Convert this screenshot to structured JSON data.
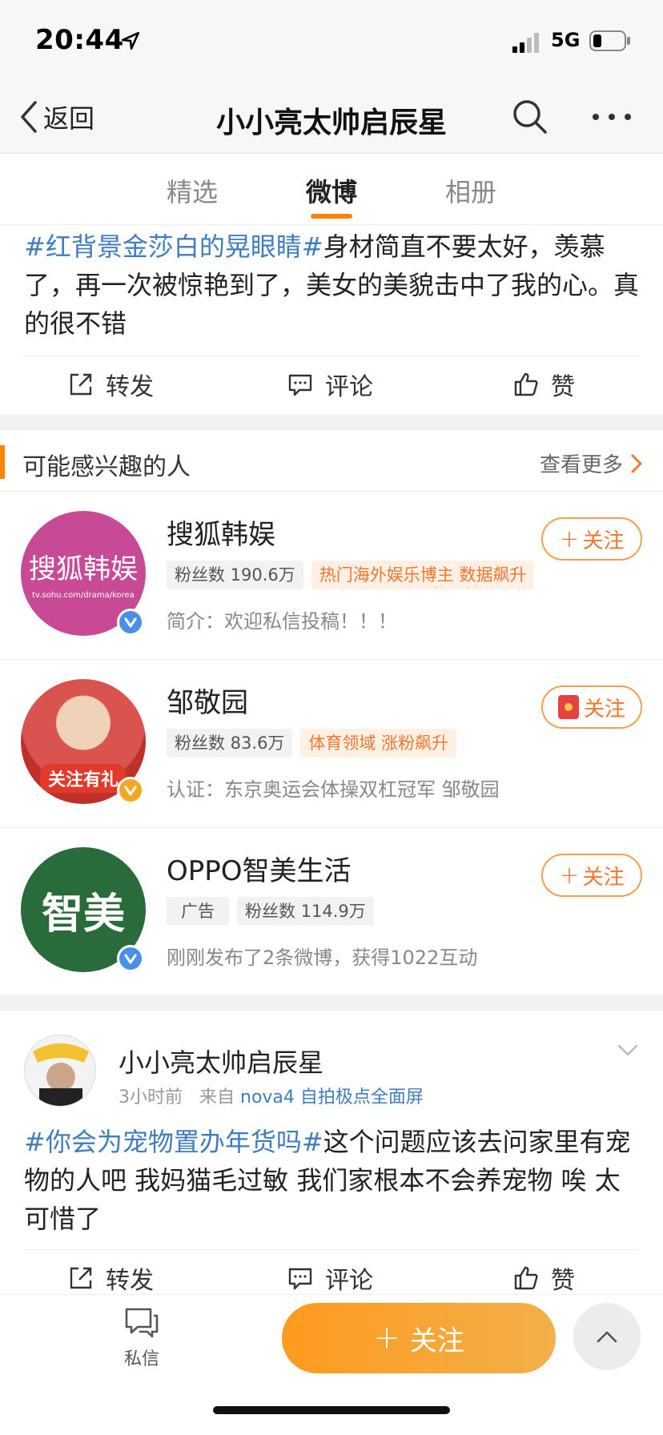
{
  "status_bar": {
    "time": "20:44",
    "network": "5G"
  },
  "nav": {
    "back_label": "返回",
    "title": "小小亮太帅启辰星"
  },
  "tabs": [
    {
      "label": "精选",
      "active": false
    },
    {
      "label": "微博",
      "active": true
    },
    {
      "label": "相册",
      "active": false
    }
  ],
  "post1": {
    "topic": "#红背景金莎白的晃眼睛#",
    "text": "身材简直不要太好，羡慕了，再一次被惊艳到了，美女的美貌击中了我的心。真的很不错"
  },
  "post_actions": {
    "repost": "转发",
    "comment": "评论",
    "like": "赞"
  },
  "recommend": {
    "title": "可能感兴趣的人",
    "more": "查看更多",
    "items": [
      {
        "name": "搜狐韩娱",
        "avatar_text": "搜狐韩娱",
        "avatar_subtext": "tv.sohu.com/drama/korea",
        "avatar_color": "#c84a95",
        "fans": "粉丝数 190.6万",
        "tags": [
          "热门海外娱乐博主 数据飙升"
        ],
        "desc": "简介：欢迎私信投稿！！！",
        "follow": "关注",
        "badge_color": "#4a8fe8"
      },
      {
        "name": "邹敬园",
        "avatar_text": "关注有礼",
        "fans": "粉丝数 83.6万",
        "tags": [
          "体育领域 涨粉飙升"
        ],
        "desc": "认证：东京奥运会体操双杠冠军 邹敬园",
        "follow": "关注",
        "badge_color": "#f5a623"
      },
      {
        "name": "OPPO智美生活",
        "avatar_text": "智美",
        "avatar_color": "#2a6b3c",
        "ad_label": "广告",
        "fans": "粉丝数 114.9万",
        "desc": "刚刚发布了2条微博，获得1022互动",
        "follow": "关注",
        "badge_color": "#4a8fe8"
      }
    ]
  },
  "post2": {
    "name": "小小亮太帅启辰星",
    "time": "3小时前",
    "from_prefix": "来自",
    "source": "nova4 自拍极点全面屏",
    "topic": "#你会为宠物置办年货吗#",
    "text": "这个问题应该去问家里有宠物的人吧 我妈猫毛过敏 我们家根本不会养宠物 唉 太可惜了"
  },
  "bottom_bar": {
    "dm_label": "私信",
    "follow_label": "关注"
  },
  "colors": {
    "accent": "#ff8200",
    "link": "#3f7dc0"
  }
}
